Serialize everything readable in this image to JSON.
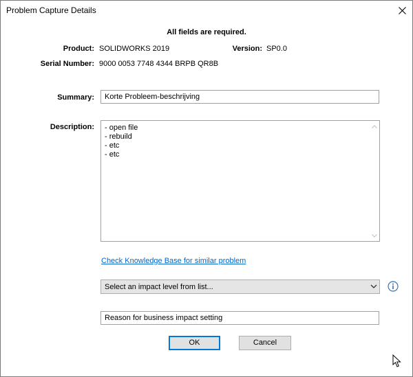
{
  "window": {
    "title": "Problem Capture Details"
  },
  "notice": "All fields are required.",
  "product": {
    "label": "Product:",
    "value": "SOLIDWORKS 2019"
  },
  "version": {
    "label": "Version:",
    "value": "SP0.0"
  },
  "serial": {
    "label": "Serial Number:",
    "value": "9000 0053 7748 4344 BRPB QR8B"
  },
  "summary": {
    "label": "Summary:",
    "value": "Korte Probleem-beschrijving"
  },
  "description": {
    "label": "Description:",
    "lines": [
      "- open file",
      "- rebuild",
      "- etc",
      "- etc"
    ]
  },
  "kb_link": "Check Knowledge Base for similar problem",
  "impact": {
    "selected": "Select an impact level from list..."
  },
  "reason": {
    "value": "Reason for business impact setting"
  },
  "buttons": {
    "ok": "OK",
    "cancel": "Cancel"
  },
  "icons": {
    "close": "close-icon",
    "info": "info-icon",
    "chevron": "chevron-down-icon"
  }
}
